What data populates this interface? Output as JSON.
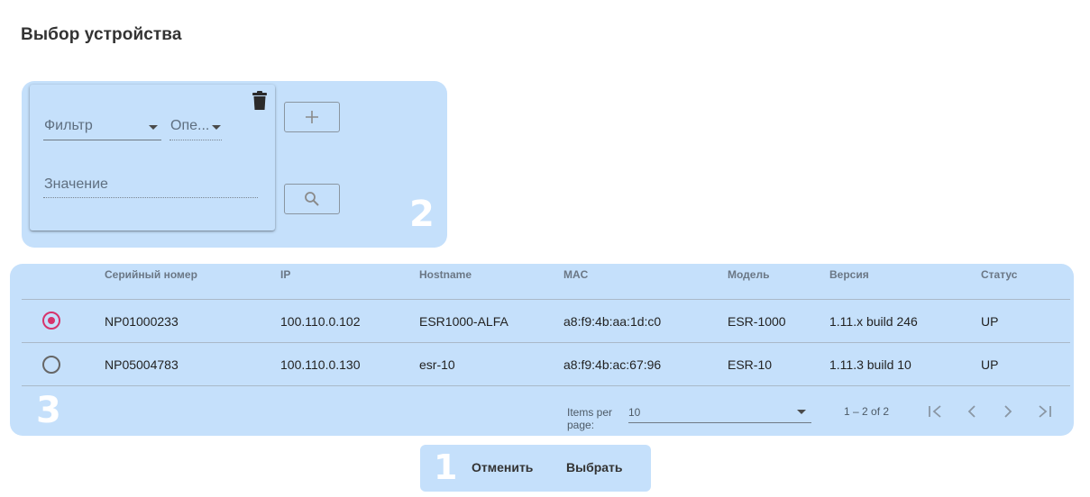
{
  "dialog": {
    "title": "Выбор устройства"
  },
  "filter": {
    "field_label": "Фильтр",
    "operator_label": "Опе...",
    "value_label": "Значение",
    "add_icon": "plus-icon",
    "search_icon": "search-icon",
    "delete_icon": "trash-icon",
    "region_number": "2"
  },
  "table": {
    "region_number": "3",
    "columns": [
      "Серийный номер",
      "IP",
      "Hostname",
      "MAC",
      "Модель",
      "Версия",
      "Статус"
    ],
    "rows": [
      {
        "selected": true,
        "serial": "NP01000233",
        "ip": "100.110.0.102",
        "hostname": "ESR1000-ALFA",
        "mac": "a8:f9:4b:aa:1d:c0",
        "model": "ESR-1000",
        "version": "1.11.x build 246",
        "status": "UP"
      },
      {
        "selected": false,
        "serial": "NP05004783",
        "ip": "100.110.0.130",
        "hostname": "esr-10",
        "mac": "a8:f9:4b:ac:67:96",
        "model": "ESR-10",
        "version": "1.11.3 build 10",
        "status": "UP"
      }
    ],
    "paginator": {
      "items_per_page_label_1": "Items per",
      "items_per_page_label_2": "page:",
      "page_size": "10",
      "range": "1 – 2 of 2"
    }
  },
  "actions": {
    "region_number": "1",
    "cancel_label": "Отменить",
    "select_label": "Выбрать"
  },
  "colors": {
    "accent": "#d6336c",
    "highlight": "#c5e0fb"
  }
}
